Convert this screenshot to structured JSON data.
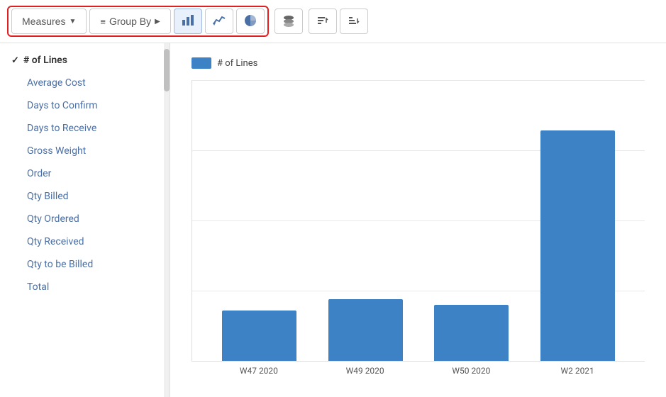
{
  "toolbar": {
    "measures_label": "Measures",
    "group_by_label": "Group By",
    "bar_chart_tooltip": "Bar Chart",
    "line_chart_tooltip": "Line Chart",
    "pie_chart_tooltip": "Pie Chart",
    "stack_btn_tooltip": "Stack",
    "sort_asc_tooltip": "Sort Ascending",
    "sort_desc_tooltip": "Sort Descending"
  },
  "sidebar": {
    "items": [
      {
        "label": "# of Lines",
        "active": true,
        "checked": true
      },
      {
        "label": "Average Cost",
        "active": false,
        "checked": false
      },
      {
        "label": "Days to Confirm",
        "active": false,
        "checked": false
      },
      {
        "label": "Days to Receive",
        "active": false,
        "checked": false
      },
      {
        "label": "Gross Weight",
        "active": false,
        "checked": false
      },
      {
        "label": "Order",
        "active": false,
        "checked": false
      },
      {
        "label": "Qty Billed",
        "active": false,
        "checked": false
      },
      {
        "label": "Qty Ordered",
        "active": false,
        "checked": false
      },
      {
        "label": "Qty Received",
        "active": false,
        "checked": false
      },
      {
        "label": "Qty to be Billed",
        "active": false,
        "checked": false
      },
      {
        "label": "Total",
        "active": false,
        "checked": false
      }
    ]
  },
  "chart": {
    "legend_label": "# of Lines",
    "bars": [
      {
        "label": "W47 2020",
        "height_pct": 18
      },
      {
        "label": "W49 2020",
        "height_pct": 22
      },
      {
        "label": "W50 2020",
        "height_pct": 20
      },
      {
        "label": "W2 2021",
        "height_pct": 82
      }
    ],
    "bar_color": "#3d82c4"
  },
  "icons": {
    "dropdown_arrow": "▼",
    "menu_lines": "≡",
    "right_arrow": "▶",
    "checkmark": "✓"
  }
}
